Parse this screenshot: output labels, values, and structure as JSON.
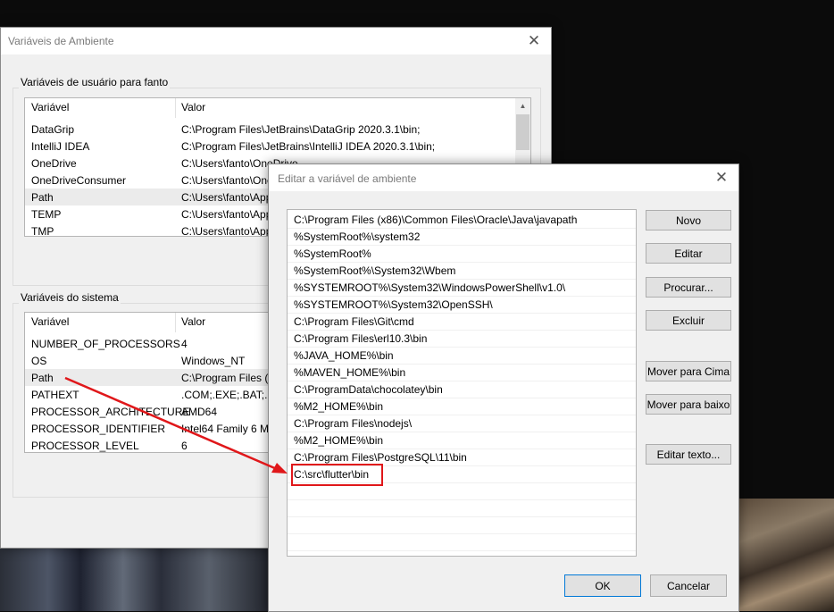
{
  "env_window": {
    "title": "Variáveis de Ambiente",
    "user_group_label": "Variáveis de usuário para fanto",
    "system_group_label": "Variáveis do sistema",
    "headers": {
      "variable": "Variável",
      "value": "Valor"
    },
    "user_vars": [
      {
        "name": "DataGrip",
        "value": "C:\\Program Files\\JetBrains\\DataGrip 2020.3.1\\bin;"
      },
      {
        "name": "IntelliJ IDEA",
        "value": "C:\\Program Files\\JetBrains\\IntelliJ IDEA 2020.3.1\\bin;"
      },
      {
        "name": "OneDrive",
        "value": "C:\\Users\\fanto\\OneDrive"
      },
      {
        "name": "OneDriveConsumer",
        "value": "C:\\Users\\fanto\\OneDrive"
      },
      {
        "name": "Path",
        "value": "C:\\Users\\fanto\\AppData"
      },
      {
        "name": "TEMP",
        "value": "C:\\Users\\fanto\\AppData"
      },
      {
        "name": "TMP",
        "value": "C:\\Users\\fanto\\AppData"
      }
    ],
    "system_vars": [
      {
        "name": "NUMBER_OF_PROCESSORS",
        "value": "4"
      },
      {
        "name": "OS",
        "value": "Windows_NT"
      },
      {
        "name": "Path",
        "value": "C:\\Program Files (x86)"
      },
      {
        "name": "PATHEXT",
        "value": ".COM;.EXE;.BAT;.CMD"
      },
      {
        "name": "PROCESSOR_ARCHITECTURE",
        "value": "AMD64"
      },
      {
        "name": "PROCESSOR_IDENTIFIER",
        "value": "Intel64 Family 6 Model"
      },
      {
        "name": "PROCESSOR_LEVEL",
        "value": "6"
      }
    ]
  },
  "edit_window": {
    "title": "Editar a variável de ambiente",
    "paths": [
      "C:\\Program Files (x86)\\Common Files\\Oracle\\Java\\javapath",
      "%SystemRoot%\\system32",
      "%SystemRoot%",
      "%SystemRoot%\\System32\\Wbem",
      "%SYSTEMROOT%\\System32\\WindowsPowerShell\\v1.0\\",
      "%SYSTEMROOT%\\System32\\OpenSSH\\",
      "C:\\Program Files\\Git\\cmd",
      "C:\\Program Files\\erl10.3\\bin",
      "%JAVA_HOME%\\bin",
      "%MAVEN_HOME%\\bin",
      "C:\\ProgramData\\chocolatey\\bin",
      "%M2_HOME%\\bin",
      "C:\\Program Files\\nodejs\\",
      "%M2_HOME%\\bin",
      "C:\\Program Files\\PostgreSQL\\11\\bin",
      "C:\\src\\flutter\\bin"
    ],
    "buttons": {
      "new": "Novo",
      "edit": "Editar",
      "browse": "Procurar...",
      "delete": "Excluir",
      "move_up": "Mover para Cima",
      "move_down": "Mover para baixo",
      "edit_text": "Editar texto...",
      "ok": "OK",
      "cancel": "Cancelar"
    }
  },
  "annotation": {
    "color": "#e0171a"
  }
}
